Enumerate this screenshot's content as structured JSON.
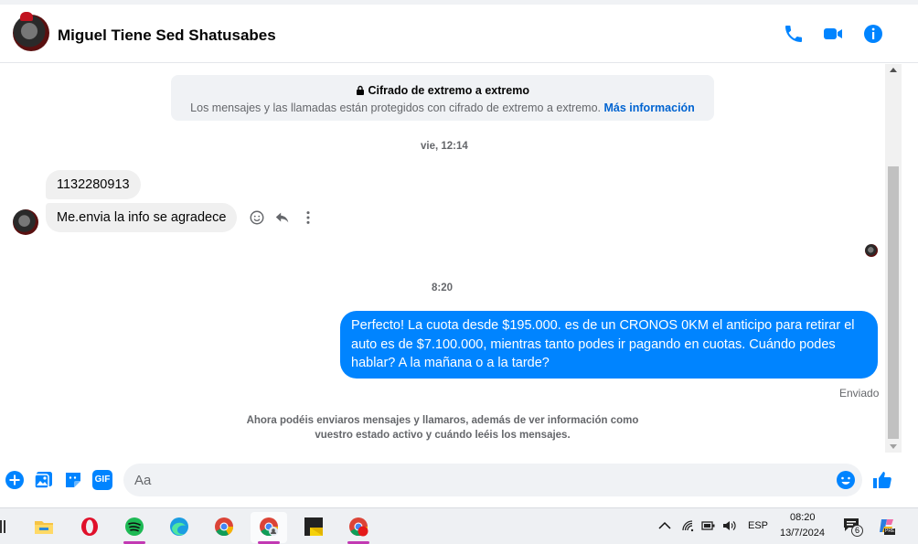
{
  "header": {
    "name": "Miguel Tiene Sed Shatusabes"
  },
  "encryption": {
    "title": "Cifrado de extremo a extremo",
    "body": "Los mensajes y las llamadas están protegidos con cifrado de extremo a extremo.",
    "link": "Más información"
  },
  "messages": {
    "timestamp1": "vie, 12:14",
    "in1": "1132280913",
    "in2": "Me.envia la info se agradece",
    "timestamp2": "8:20",
    "out1": "Perfecto! La cuota desde $195.000. es de un CRONOS 0KM el anticipo para retirar el auto es de $7.100.000, mientras tanto podes ir pagando en cuotas. Cuándo podes hablar? A la mañana o a la tarde?",
    "status": "Enviado"
  },
  "notice": {
    "line1": "Ahora podéis enviaros mensajes y llamaros, además de ver información como",
    "line2": "vuestro estado activo y cuándo leéis los mensajes."
  },
  "composer": {
    "placeholder": "Aa",
    "gif_label": "GIF"
  },
  "taskbar": {
    "lang": "ESP",
    "time": "08:20",
    "date": "13/7/2024",
    "notification_count": "6",
    "copilot_badge": "PRE"
  },
  "colors": {
    "accent": "#0084ff",
    "link": "#0064d1",
    "taskbar_indicator": "#c239b3"
  }
}
